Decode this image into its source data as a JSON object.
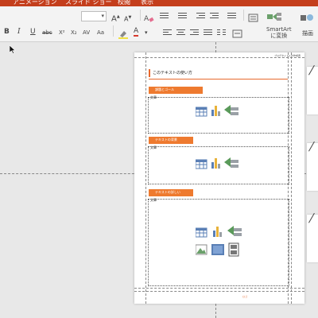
{
  "menubar": {
    "items": [
      "アニメーション",
      "スライド ショー",
      "校閲",
      "表示"
    ]
  },
  "ribbon": {
    "font_size_value": "",
    "grow_font": "A",
    "shrink_font": "A",
    "bold": "B",
    "italic": "I",
    "underline": "U",
    "strikethrough": "abc",
    "superscript": "X²",
    "subscript": "X₂",
    "char_spacing": "AV",
    "change_case": "Aa",
    "font_color": "A",
    "smartart_label_line1": "SmartArt",
    "smartart_label_line2": "に変換",
    "drawing_label": "描画"
  },
  "slide": {
    "header_text": "ブログタイトルや作成者",
    "title": "このテキストの使い方",
    "sections": [
      {
        "banner": "課題とゴール",
        "label": "文章"
      },
      {
        "banner": "テキストの背景",
        "label": "文章"
      },
      {
        "banner": "テキストの詳しい",
        "label": "文章"
      }
    ],
    "footer_text": "ロゴ"
  },
  "colors": {
    "ribbon_accent": "#c43e1c",
    "slide_accent": "#ee7a2f",
    "workspace": "#e8e8e8"
  },
  "icons": {
    "table": "table-icon",
    "chart": "chart-icon",
    "smartart": "smartart-icon",
    "picture": "picture-icon",
    "online_picture": "online-picture-icon",
    "video": "video-icon"
  }
}
